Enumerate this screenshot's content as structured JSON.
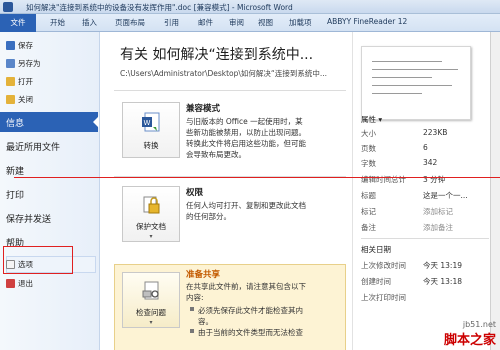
{
  "window": {
    "title": "如何解决\"连接到系统中的设备没有发挥作用\".doc [兼容模式] - Microsoft Word"
  },
  "ribbon": {
    "tabs": [
      "文件",
      "开始",
      "插入",
      "页面布局",
      "引用",
      "邮件",
      "审阅",
      "视图",
      "加载项",
      "ABBYY FineReader 12"
    ]
  },
  "nav": {
    "save": "保存",
    "save_as": "另存为",
    "open": "打开",
    "close": "关闭",
    "info": "信息",
    "recent": "最近所用文件",
    "new": "新建",
    "print": "打印",
    "save_send": "保存并发送",
    "help": "帮助",
    "options": "选项",
    "exit": "退出"
  },
  "main": {
    "title": "有关 如何解决“连接到系统中...",
    "path": "C:\\Users\\Administrator\\Desktop\\如何解决“连接到系统中...",
    "compat": {
      "button": "转换",
      "heading": "兼容模式",
      "text": [
        "与旧版本的 Office 一起使用时，某",
        "些新功能被禁用，以防止出现问题。",
        "转换此文件将启用这些功能，但可能",
        "会导致布局更改。"
      ]
    },
    "perm": {
      "button": "保护文档",
      "heading": "权限",
      "text": [
        "任何人均可打开、复制和更改此文档",
        "的任何部分。"
      ]
    },
    "inspect": {
      "button": "检查问题",
      "heading": "准备共享",
      "text": [
        "在共享此文件前，请注意其包含以下",
        "内容:"
      ],
      "bullets": [
        "必须先保存此文件才能检查其内",
        "容。",
        "由于当前的文件类型而无法检查"
      ]
    }
  },
  "properties": {
    "heading": "属性 ▾",
    "rows": [
      {
        "label": "大小",
        "value": "223KB"
      },
      {
        "label": "页数",
        "value": "6"
      },
      {
        "label": "字数",
        "value": "342"
      },
      {
        "label": "编辑时间总计",
        "value": "3 分钟"
      },
      {
        "label": "标题",
        "value": "这是一个一..."
      },
      {
        "label": "标记",
        "value": "添加标记"
      },
      {
        "label": "备注",
        "value": "添加备注"
      }
    ],
    "dates_heading": "相关日期",
    "dates": [
      {
        "label": "上次修改时间",
        "value": "今天 13:19"
      },
      {
        "label": "创建时间",
        "value": "今天 13:18"
      },
      {
        "label": "上次打印时间",
        "value": ""
      }
    ]
  },
  "watermark": {
    "line1": "jb51.net",
    "line2": "脚本之家"
  },
  "colors": {
    "accent": "#2b62b5",
    "highlight_border": "#e02020",
    "share_bg": "#fdf3d4"
  }
}
